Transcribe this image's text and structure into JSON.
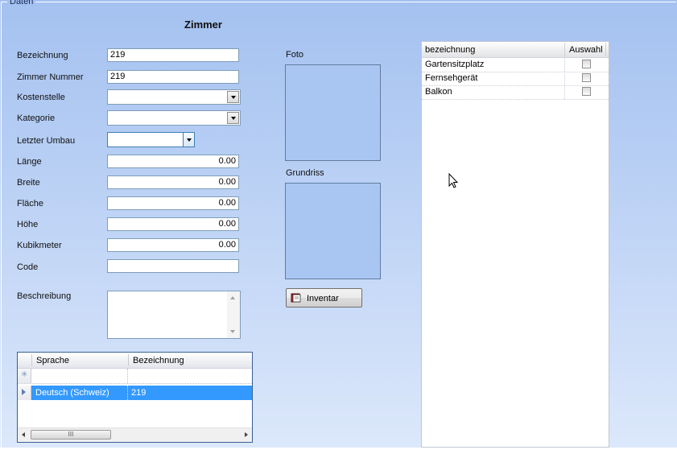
{
  "group": {
    "legend": "Daten"
  },
  "title": "Zimmer",
  "fields": {
    "bezeichnung": {
      "label": "Bezeichnung",
      "value": "219"
    },
    "zimmer_nummer": {
      "label": "Zimmer Nummer",
      "value": "219"
    },
    "kostenstelle": {
      "label": "Kostenstelle",
      "value": ""
    },
    "kategorie": {
      "label": "Kategorie",
      "value": ""
    },
    "letzter_umbau": {
      "label": "Letzter Umbau",
      "value": ""
    },
    "laenge": {
      "label": "Länge",
      "value": "0.00"
    },
    "breite": {
      "label": "Breite",
      "value": "0.00"
    },
    "flaeche": {
      "label": "Fläche",
      "value": "0.00"
    },
    "hoehe": {
      "label": "Höhe",
      "value": "0.00"
    },
    "kubikmeter": {
      "label": "Kubikmeter",
      "value": "0.00"
    },
    "code": {
      "label": "Code",
      "value": ""
    },
    "beschreibung": {
      "label": "Beschreibung",
      "value": ""
    }
  },
  "foto": {
    "label": "Foto"
  },
  "grundriss": {
    "label": "Grundriss"
  },
  "inventar_button": "Inventar",
  "language_grid": {
    "columns": [
      "Sprache",
      "Bezeichnung"
    ],
    "rows": [
      {
        "sprache": "Deutsch (Schweiz)",
        "bezeichnung": "219",
        "selected": true
      }
    ],
    "scroll_thumb_text": "III"
  },
  "features_list": {
    "columns": [
      "bezeichnung",
      "Auswahl"
    ],
    "rows": [
      {
        "bezeichnung": "Gartensitzplatz",
        "auswahl": false
      },
      {
        "bezeichnung": "Fernsehgerät",
        "auswahl": false
      },
      {
        "bezeichnung": "Balkon",
        "auswahl": false
      }
    ]
  },
  "colors": {
    "background_top": "#a4c1f0",
    "selection": "#3399ff",
    "picture_fill": "#a9c6f3"
  }
}
